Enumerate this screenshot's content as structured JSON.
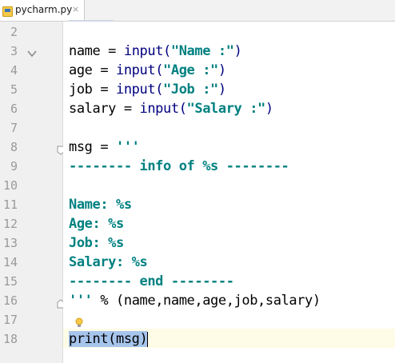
{
  "tab": {
    "filename": "pycharm.py",
    "close_glyph": "×",
    "icon": "python-file-icon"
  },
  "line_numbers": [
    "2",
    "3",
    "4",
    "5",
    "6",
    "7",
    "8",
    "9",
    "10",
    "11",
    "12",
    "13",
    "14",
    "15",
    "16",
    "17",
    "18"
  ],
  "code": [
    {
      "parts": []
    },
    {
      "parts": [
        {
          "t": "name = ",
          "c": "plain"
        },
        {
          "t": "input(",
          "c": "fn"
        },
        {
          "t": "\"Name :\"",
          "c": "str"
        },
        {
          "t": ")",
          "c": "fn"
        }
      ]
    },
    {
      "parts": [
        {
          "t": "age = ",
          "c": "plain"
        },
        {
          "t": "input(",
          "c": "fn"
        },
        {
          "t": "\"Age :\"",
          "c": "str"
        },
        {
          "t": ")",
          "c": "fn"
        }
      ]
    },
    {
      "parts": [
        {
          "t": "job = ",
          "c": "plain"
        },
        {
          "t": "input(",
          "c": "fn"
        },
        {
          "t": "\"Job :\"",
          "c": "str"
        },
        {
          "t": ")",
          "c": "fn"
        }
      ]
    },
    {
      "parts": [
        {
          "t": "salary = ",
          "c": "plain"
        },
        {
          "t": "input(",
          "c": "fn"
        },
        {
          "t": "\"Salary :\"",
          "c": "str"
        },
        {
          "t": ")",
          "c": "fn"
        }
      ]
    },
    {
      "parts": []
    },
    {
      "parts": [
        {
          "t": "msg = ",
          "c": "plain"
        },
        {
          "t": "'''",
          "c": "str"
        }
      ]
    },
    {
      "parts": [
        {
          "t": "-------- info of %s --------",
          "c": "str"
        }
      ]
    },
    {
      "parts": []
    },
    {
      "parts": [
        {
          "t": "Name: %s",
          "c": "str"
        }
      ]
    },
    {
      "parts": [
        {
          "t": "Age: %s",
          "c": "str"
        }
      ]
    },
    {
      "parts": [
        {
          "t": "Job: %s",
          "c": "str"
        }
      ]
    },
    {
      "parts": [
        {
          "t": "Salary: %s",
          "c": "str"
        }
      ]
    },
    {
      "parts": [
        {
          "t": "-------- end --------",
          "c": "str"
        }
      ]
    },
    {
      "parts": [
        {
          "t": "'''",
          "c": "str"
        },
        {
          "t": " % (name,name,age,job,salary)",
          "c": "plain"
        }
      ]
    },
    {
      "parts": []
    },
    {
      "parts": [
        {
          "t": "print(msg)",
          "c": "selected"
        }
      ]
    }
  ],
  "current_line_index": 16,
  "colors": {
    "function": "#000080",
    "string": "#008080",
    "selection": "#a6c4ec",
    "current_line": "#fefce7",
    "gutter": "#f0f0f0"
  }
}
